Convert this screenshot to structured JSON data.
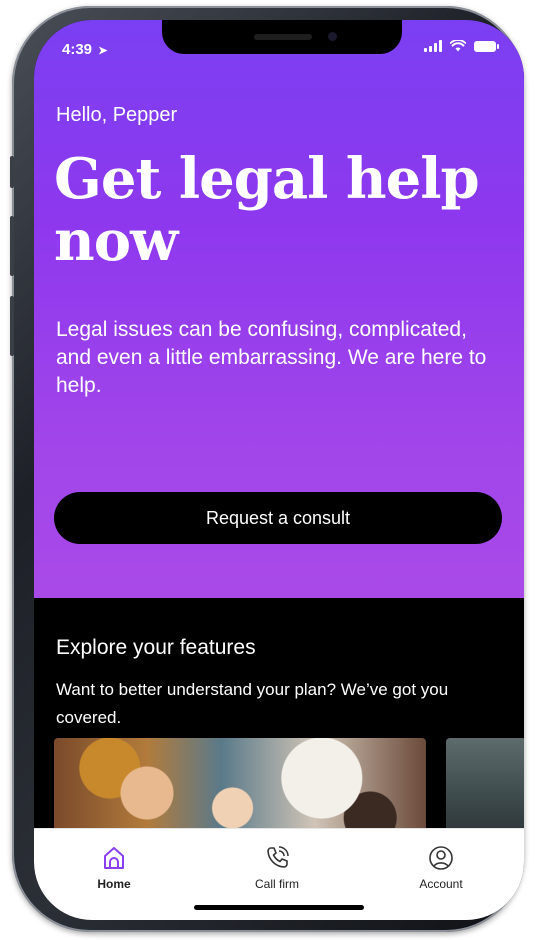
{
  "status_bar": {
    "time": "4:39"
  },
  "hero": {
    "greeting": "Hello, Pepper",
    "headline": "Get legal help now",
    "subtext": "Legal issues can be confusing, complicated, and even a little embarrassing. We are here to help.",
    "cta_label": "Request a consult"
  },
  "features": {
    "title": "Explore your features",
    "description": "Want to better understand your plan? We’ve got you covered."
  },
  "tabs": [
    {
      "label": "Home",
      "icon": "home-icon",
      "active": true
    },
    {
      "label": "Call firm",
      "icon": "phone-icon",
      "active": false
    },
    {
      "label": "Account",
      "icon": "account-icon",
      "active": false
    }
  ],
  "colors": {
    "accent_purple": "#8a3ff0",
    "active_tab_icon": "#8a3ff0",
    "button_bg": "#000000"
  }
}
